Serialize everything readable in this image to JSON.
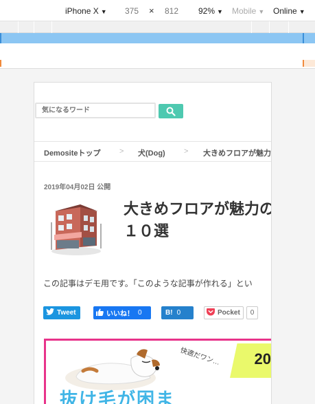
{
  "devtools": {
    "device": "iPhone X",
    "width": "375",
    "times": "×",
    "height": "812",
    "zoom": "92%",
    "mode": "Mobile",
    "network": "Online",
    "caret": "▼"
  },
  "search": {
    "placeholder": "気になるワード"
  },
  "breadcrumb": {
    "items": [
      "Demositeトップ",
      "犬(Dog)",
      "大きめフロアが魅力"
    ],
    "separator": ">"
  },
  "article": {
    "date": "2019年04月02日 公開",
    "title": "大きめフロアが魅力の\n１０選",
    "lead": "この記事はデモ用です。「このような記事が作れる」とい"
  },
  "share": {
    "tweet": "Tweet",
    "facebook": "いいね！",
    "facebook_count": "0",
    "hatena": "B!",
    "hatena_count": "0",
    "pocket": "Pocket",
    "pocket_count": "0"
  },
  "banner": {
    "tagline": "快適だワン…",
    "number": "20",
    "headline": "抜け毛が困ま"
  },
  "colors": {
    "search_button": "#4ec9b0",
    "twitter": "#1b95e0",
    "facebook": "#1877f2",
    "hatena": "#2581cc",
    "banner_border": "#e8338a",
    "banner_headline": "#40b5e6"
  }
}
